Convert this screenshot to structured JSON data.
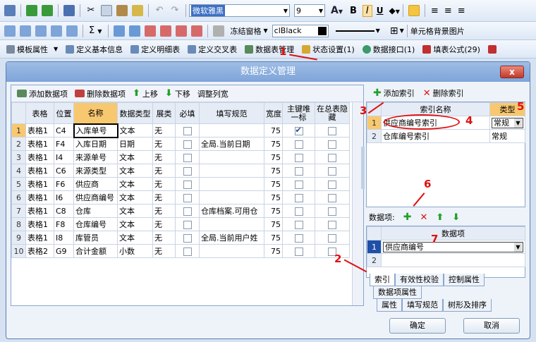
{
  "toolbar1": {
    "font_name": "微软雅黑",
    "font_size": "9"
  },
  "toolbar2": {
    "freeze_label": "冻结窗格",
    "color_value": "clBlack",
    "cell_bg_label": "单元格背景图片"
  },
  "toolbar3": {
    "items": [
      "模板属性",
      "定义基本信息",
      "定义明细表",
      "定义交叉表",
      "数据表管理",
      "状态设置(1)",
      "数据接口(1)",
      "填表公式(29)"
    ]
  },
  "dialog": {
    "title": "数据定义管理",
    "close": "x"
  },
  "left_toolbar": {
    "add": "添加数据项",
    "delete": "删除数据项",
    "up": "上移",
    "down": "下移",
    "adjust": "调整列宽"
  },
  "grid": {
    "columns": [
      "",
      "表格",
      "位置",
      "名称",
      "数据类型",
      "展类",
      "必填",
      "填写规范",
      "宽度",
      "主键唯一标",
      "在总表隐藏"
    ],
    "rows": [
      {
        "n": "1",
        "table": "表格1",
        "pos": "C4",
        "name": "入库单号",
        "type": "文本",
        "ext": "无",
        "fill": "",
        "width": "75",
        "pk": true
      },
      {
        "n": "2",
        "table": "表格1",
        "pos": "F4",
        "name": "入库日期",
        "type": "日期",
        "ext": "无",
        "fill": "全局.当前日期",
        "width": "75",
        "pk": false
      },
      {
        "n": "3",
        "table": "表格1",
        "pos": "I4",
        "name": "来源单号",
        "type": "文本",
        "ext": "无",
        "fill": "",
        "width": "75",
        "pk": false
      },
      {
        "n": "4",
        "table": "表格1",
        "pos": "C6",
        "name": "来源类型",
        "type": "文本",
        "ext": "无",
        "fill": "",
        "width": "75",
        "pk": false
      },
      {
        "n": "5",
        "table": "表格1",
        "pos": "F6",
        "name": "供应商",
        "type": "文本",
        "ext": "无",
        "fill": "",
        "width": "75",
        "pk": false
      },
      {
        "n": "6",
        "table": "表格1",
        "pos": "I6",
        "name": "供应商编号",
        "type": "文本",
        "ext": "无",
        "fill": "",
        "width": "75",
        "pk": false
      },
      {
        "n": "7",
        "table": "表格1",
        "pos": "C8",
        "name": "仓库",
        "type": "文本",
        "ext": "无",
        "fill": "仓库档案.可用仓",
        "width": "75",
        "pk": false
      },
      {
        "n": "8",
        "table": "表格1",
        "pos": "F8",
        "name": "仓库编号",
        "type": "文本",
        "ext": "无",
        "fill": "",
        "width": "75",
        "pk": false
      },
      {
        "n": "9",
        "table": "表格1",
        "pos": "I8",
        "name": "库管员",
        "type": "文本",
        "ext": "无",
        "fill": "全局.当前用户姓",
        "width": "75",
        "pk": false
      },
      {
        "n": "10",
        "table": "表格2",
        "pos": "G9",
        "name": "合计金额",
        "type": "小数",
        "ext": "无",
        "fill": "",
        "width": "75",
        "pk": false
      }
    ]
  },
  "index_panel": {
    "add": "添加索引",
    "delete": "删除索引",
    "col_name": "索引名称",
    "col_type": "类型",
    "rows": [
      {
        "n": "1",
        "name": "供应商编号索引",
        "type": "常规"
      },
      {
        "n": "2",
        "name": "仓库编号索引",
        "type": "常规"
      }
    ],
    "data_items_label": "数据项:",
    "items_header": "数据项",
    "items": [
      {
        "n": "1",
        "value": "供应商编号"
      },
      {
        "n": "2",
        "value": ""
      }
    ]
  },
  "tabs_row1": [
    "索引",
    "有效性校验",
    "控制属性"
  ],
  "tabs_row2": [
    "数据项属性"
  ],
  "tabs_row3": [
    "属性",
    "填写规范",
    "树形及排序"
  ],
  "buttons": {
    "ok": "确定",
    "cancel": "取消"
  },
  "annotations": [
    "1",
    "2",
    "3",
    "4",
    "5",
    "6",
    "7"
  ]
}
